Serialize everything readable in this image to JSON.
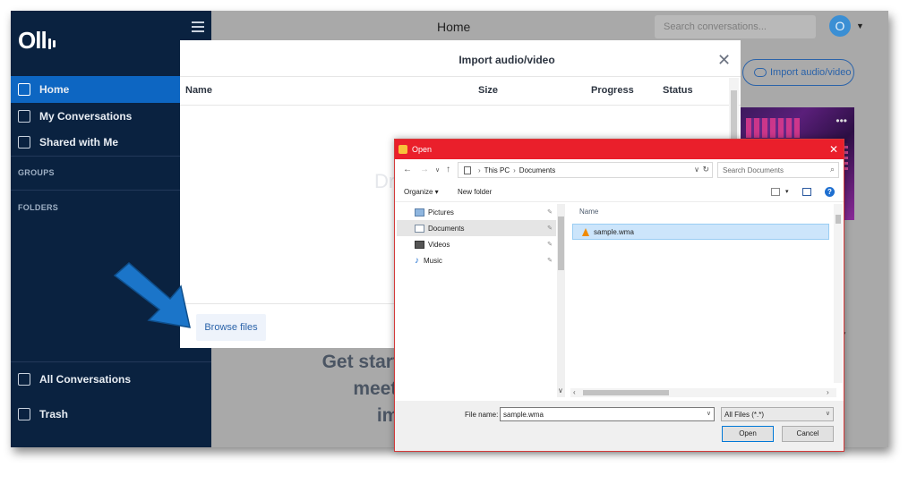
{
  "app": {
    "logo_text": "Oll",
    "page_title": "Home",
    "search_placeholder": "Search conversations...",
    "avatar_initial": "O"
  },
  "sidebar": {
    "items": [
      {
        "label": "Home",
        "active": true
      },
      {
        "label": "My Conversations",
        "active": false
      },
      {
        "label": "Shared with Me",
        "active": false
      }
    ],
    "groups_label": "GROUPS",
    "folders_label": "FOLDERS",
    "bottom_items": [
      {
        "label": "All Conversations"
      },
      {
        "label": "Trash"
      }
    ]
  },
  "background": {
    "import_button_label": "Import audio/video",
    "get_started_lines": [
      "Get started",
      "meeting,",
      "impor"
    ]
  },
  "import_modal": {
    "title": "Import audio/video",
    "columns": [
      "Name",
      "Size",
      "Progress",
      "Status"
    ],
    "drop_hint": "Dr",
    "browse_label": "Browse files"
  },
  "open_dialog": {
    "title": "Open",
    "path": [
      "This PC",
      "Documents"
    ],
    "search_placeholder": "Search Documents",
    "organize_label": "Organize ▾",
    "new_folder_label": "New folder",
    "folders": [
      {
        "label": "Pictures",
        "selected": false
      },
      {
        "label": "Documents",
        "selected": true
      },
      {
        "label": "Videos",
        "selected": false
      },
      {
        "label": "Music",
        "selected": false
      }
    ],
    "name_header": "Name",
    "files": [
      {
        "label": "sample.wma",
        "selected": true
      }
    ],
    "file_name_label": "File name:",
    "file_name_value": "sample.wma",
    "filter_value": "All Files (*.*)",
    "open_label": "Open",
    "cancel_label": "Cancel"
  },
  "colors": {
    "sidebar_bg": "#0a2240",
    "active_nav": "#0d66c2",
    "dialog_titlebar": "#ea1f2b",
    "annotation_arrow": "#1b75c9"
  }
}
